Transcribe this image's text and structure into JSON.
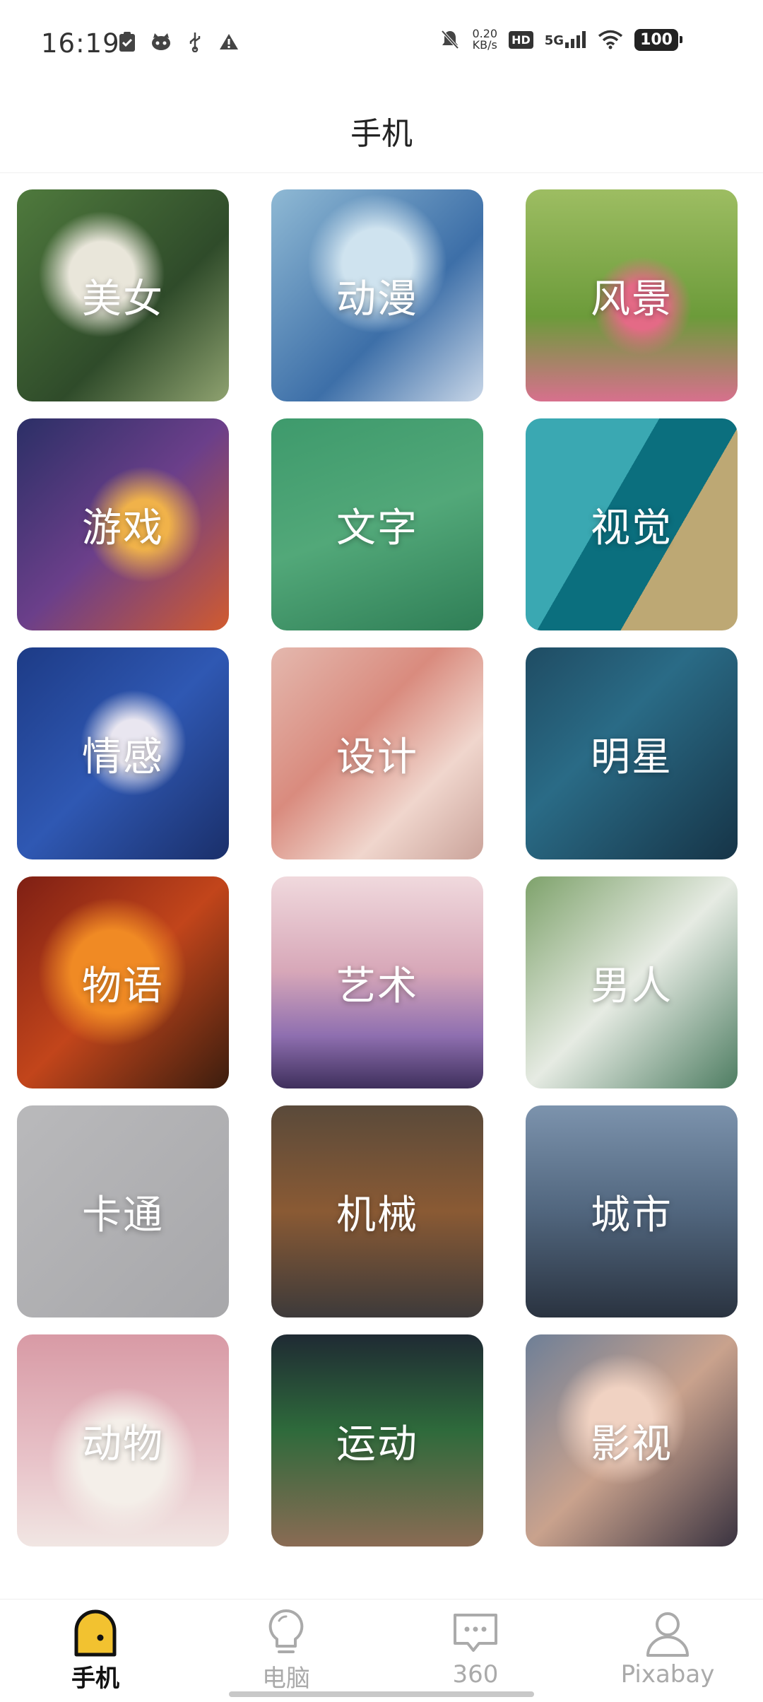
{
  "status_bar": {
    "time": "16:19",
    "net_speed_value": "0.20",
    "net_speed_unit": "KB/s",
    "hd": "HD",
    "network_type": "5G",
    "battery": "100"
  },
  "header": {
    "title": "手机"
  },
  "categories": [
    {
      "label": "美女"
    },
    {
      "label": "动漫"
    },
    {
      "label": "风景"
    },
    {
      "label": "游戏"
    },
    {
      "label": "文字"
    },
    {
      "label": "视觉"
    },
    {
      "label": "情感"
    },
    {
      "label": "设计"
    },
    {
      "label": "明星"
    },
    {
      "label": "物语"
    },
    {
      "label": "艺术"
    },
    {
      "label": "男人"
    },
    {
      "label": "卡通"
    },
    {
      "label": "机械"
    },
    {
      "label": "城市"
    },
    {
      "label": "动物"
    },
    {
      "label": "运动"
    },
    {
      "label": "影视"
    }
  ],
  "bottom_nav": {
    "items": [
      {
        "label": "手机",
        "icon": "phone-arch-icon",
        "active": true
      },
      {
        "label": "电脑",
        "icon": "lightbulb-icon",
        "active": false
      },
      {
        "label": "360",
        "icon": "chat-bubble-icon",
        "active": false
      },
      {
        "label": "Pixabay",
        "icon": "user-icon",
        "active": false
      }
    ]
  },
  "colors": {
    "accent": "#f2c230",
    "active_text": "#111111",
    "inactive_text": "#aaaaaa"
  }
}
